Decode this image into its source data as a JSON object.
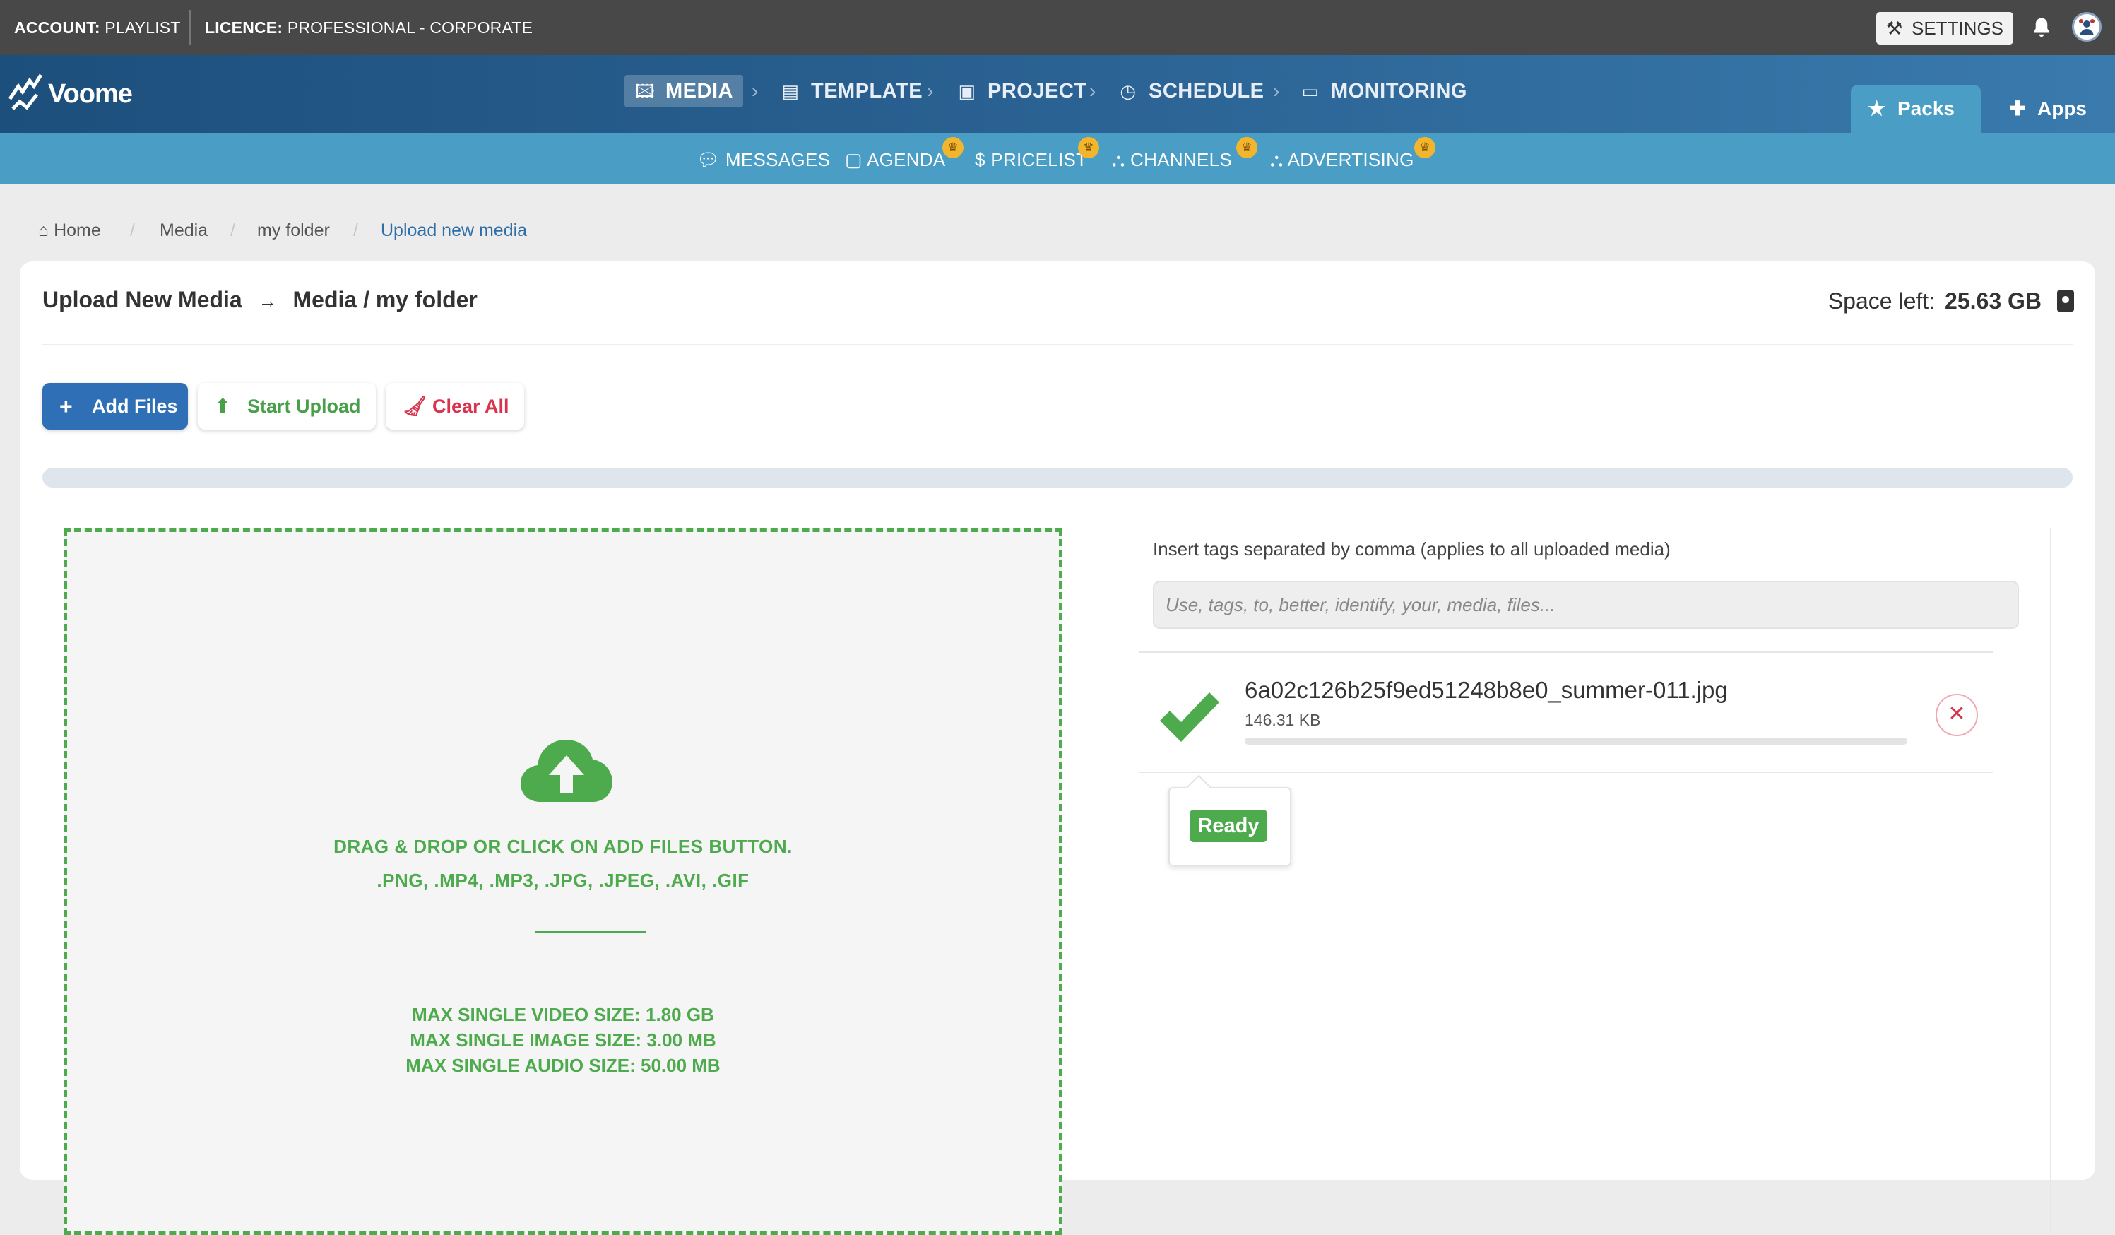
{
  "topbar": {
    "account_key": "ACCOUNT:",
    "account_value": "PLAYLIST",
    "licence_key": "LICENCE:",
    "licence_value": "PROFESSIONAL - CORPORATE",
    "settings_label": "SETTINGS"
  },
  "brand": {
    "name": "Voome"
  },
  "mainnav": {
    "items": [
      {
        "label": "MEDIA",
        "icon": "image-icon",
        "active": true
      },
      {
        "label": "TEMPLATE",
        "icon": "book-icon"
      },
      {
        "label": "PROJECT",
        "icon": "project-icon"
      },
      {
        "label": "SCHEDULE",
        "icon": "clock-icon"
      },
      {
        "label": "MONITORING",
        "icon": "monitor-icon"
      }
    ],
    "packs_label": "Packs",
    "apps_label": "Apps"
  },
  "subnav": {
    "items": [
      {
        "label": "MESSAGES",
        "icon": "chat-icon",
        "premium": false
      },
      {
        "label": "AGENDA",
        "icon": "calendar-icon",
        "premium": true
      },
      {
        "label": "PRICELIST",
        "icon": "dollar-icon",
        "premium": true
      },
      {
        "label": "CHANNELS",
        "icon": "sitemap-icon",
        "premium": true
      },
      {
        "label": "ADVERTISING",
        "icon": "sitemap-icon",
        "premium": true
      }
    ]
  },
  "breadcrumb": {
    "items": [
      "Home",
      "Media",
      "my folder",
      "Upload new media"
    ]
  },
  "page": {
    "title_left": "Upload New Media",
    "title_arrow": "→",
    "title_right": "Media / my folder",
    "space_left_label": "Space left:",
    "space_left_value": "25.63 GB"
  },
  "toolbar": {
    "add_files_label": "Add Files",
    "start_upload_label": "Start Upload",
    "clear_all_label": "Clear All",
    "overall_progress_pct": 0
  },
  "dropzone": {
    "line1": "DRAG & DROP OR CLICK ON ADD FILES BUTTON.",
    "line2": ".PNG, .MP4, .MP3, .JPG, .JPEG, .AVI, .GIF",
    "max_video": "MAX SINGLE VIDEO SIZE:  1.80 GB",
    "max_image": "MAX SINGLE IMAGE SIZE:  3.00 MB",
    "max_audio": "MAX SINGLE AUDIO SIZE:  50.00 MB"
  },
  "tags": {
    "label": "Insert tags separated by comma (applies to all uploaded media)",
    "placeholder": "Use, tags, to, better, identify, your, media, files...",
    "value": ""
  },
  "file": {
    "name": "6a02c126b25f9ed51248b8e0_summer-011.jpg",
    "size": "146.31 KB",
    "progress_pct": 0,
    "status": "Ready"
  },
  "colors": {
    "topbar": "#484848",
    "nav_dark": "#1d4f7c",
    "subnav": "#4a9dc4",
    "primary": "#2e6fb5",
    "success": "#4daa4d",
    "danger": "#d9344d",
    "crown": "#f1b52e"
  }
}
